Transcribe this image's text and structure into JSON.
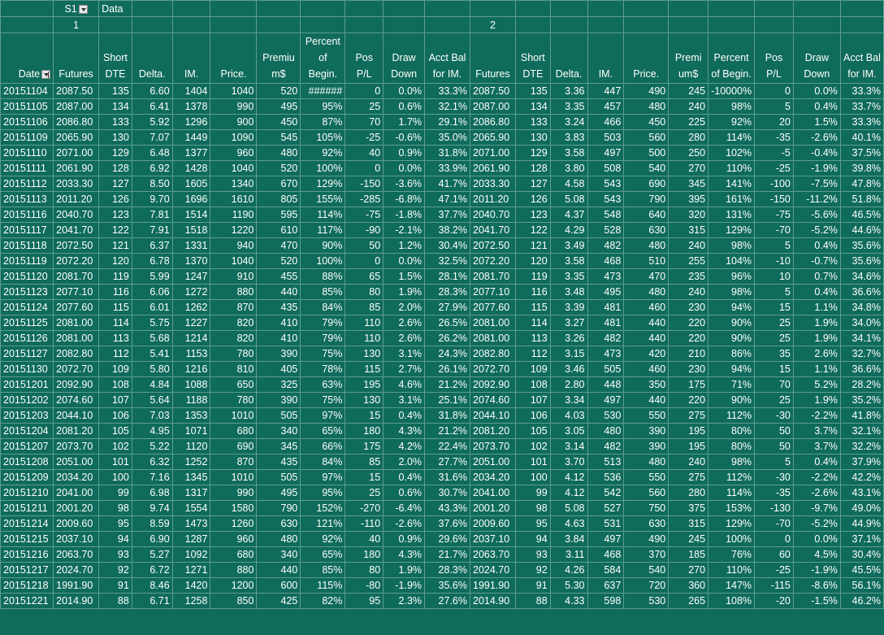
{
  "pivot": {
    "field_label": "S1",
    "data_label": "Data",
    "group1": "1",
    "group2": "2"
  },
  "headers": [
    "Date",
    "Futures",
    "Short DTE",
    "Delta.",
    "IM.",
    "Price.",
    "Premiu m$",
    "Percent of Begin.",
    "Pos P/L",
    "Draw Down",
    "Acct Bal for IM.",
    "Futures",
    "Short DTE",
    "Delta.",
    "IM.",
    "Price.",
    "Premi um$",
    "Percent of Begin.",
    "Pos P/L",
    "Draw Down",
    "Acct Bal for IM."
  ],
  "rows": [
    [
      "20151104",
      "2087.50",
      "135",
      "6.60",
      "1404",
      "1040",
      "520",
      "######",
      "0",
      "0.0%",
      "33.3%",
      "2087.50",
      "135",
      "3.36",
      "447",
      "490",
      "245",
      "-10000%",
      "0",
      "0.0%",
      "33.3%"
    ],
    [
      "20151105",
      "2087.00",
      "134",
      "6.41",
      "1378",
      "990",
      "495",
      "95%",
      "25",
      "0.6%",
      "32.1%",
      "2087.00",
      "134",
      "3.35",
      "457",
      "480",
      "240",
      "98%",
      "5",
      "0.4%",
      "33.7%"
    ],
    [
      "20151106",
      "2086.80",
      "133",
      "5.92",
      "1296",
      "900",
      "450",
      "87%",
      "70",
      "1.7%",
      "29.1%",
      "2086.80",
      "133",
      "3.24",
      "466",
      "450",
      "225",
      "92%",
      "20",
      "1.5%",
      "33.3%"
    ],
    [
      "20151109",
      "2065.90",
      "130",
      "7.07",
      "1449",
      "1090",
      "545",
      "105%",
      "-25",
      "-0.6%",
      "35.0%",
      "2065.90",
      "130",
      "3.83",
      "503",
      "560",
      "280",
      "114%",
      "-35",
      "-2.6%",
      "40.1%"
    ],
    [
      "20151110",
      "2071.00",
      "129",
      "6.48",
      "1377",
      "960",
      "480",
      "92%",
      "40",
      "0.9%",
      "31.8%",
      "2071.00",
      "129",
      "3.58",
      "497",
      "500",
      "250",
      "102%",
      "-5",
      "-0.4%",
      "37.5%"
    ],
    [
      "20151111",
      "2061.90",
      "128",
      "6.92",
      "1428",
      "1040",
      "520",
      "100%",
      "0",
      "0.0%",
      "33.9%",
      "2061.90",
      "128",
      "3.80",
      "508",
      "540",
      "270",
      "110%",
      "-25",
      "-1.9%",
      "39.8%"
    ],
    [
      "20151112",
      "2033.30",
      "127",
      "8.50",
      "1605",
      "1340",
      "670",
      "129%",
      "-150",
      "-3.6%",
      "41.7%",
      "2033.30",
      "127",
      "4.58",
      "543",
      "690",
      "345",
      "141%",
      "-100",
      "-7.5%",
      "47.8%"
    ],
    [
      "20151113",
      "2011.20",
      "126",
      "9.70",
      "1696",
      "1610",
      "805",
      "155%",
      "-285",
      "-6.8%",
      "47.1%",
      "2011.20",
      "126",
      "5.08",
      "543",
      "790",
      "395",
      "161%",
      "-150",
      "-11.2%",
      "51.8%"
    ],
    [
      "20151116",
      "2040.70",
      "123",
      "7.81",
      "1514",
      "1190",
      "595",
      "114%",
      "-75",
      "-1.8%",
      "37.7%",
      "2040.70",
      "123",
      "4.37",
      "548",
      "640",
      "320",
      "131%",
      "-75",
      "-5.6%",
      "46.5%"
    ],
    [
      "20151117",
      "2041.70",
      "122",
      "7.91",
      "1518",
      "1220",
      "610",
      "117%",
      "-90",
      "-2.1%",
      "38.2%",
      "2041.70",
      "122",
      "4.29",
      "528",
      "630",
      "315",
      "129%",
      "-70",
      "-5.2%",
      "44.6%"
    ],
    [
      "20151118",
      "2072.50",
      "121",
      "6.37",
      "1331",
      "940",
      "470",
      "90%",
      "50",
      "1.2%",
      "30.4%",
      "2072.50",
      "121",
      "3.49",
      "482",
      "480",
      "240",
      "98%",
      "5",
      "0.4%",
      "35.6%"
    ],
    [
      "20151119",
      "2072.20",
      "120",
      "6.78",
      "1370",
      "1040",
      "520",
      "100%",
      "0",
      "0.0%",
      "32.5%",
      "2072.20",
      "120",
      "3.58",
      "468",
      "510",
      "255",
      "104%",
      "-10",
      "-0.7%",
      "35.6%"
    ],
    [
      "20151120",
      "2081.70",
      "119",
      "5.99",
      "1247",
      "910",
      "455",
      "88%",
      "65",
      "1.5%",
      "28.1%",
      "2081.70",
      "119",
      "3.35",
      "473",
      "470",
      "235",
      "96%",
      "10",
      "0.7%",
      "34.6%"
    ],
    [
      "20151123",
      "2077.10",
      "116",
      "6.06",
      "1272",
      "880",
      "440",
      "85%",
      "80",
      "1.9%",
      "28.3%",
      "2077.10",
      "116",
      "3.48",
      "495",
      "480",
      "240",
      "98%",
      "5",
      "0.4%",
      "36.6%"
    ],
    [
      "20151124",
      "2077.60",
      "115",
      "6.01",
      "1262",
      "870",
      "435",
      "84%",
      "85",
      "2.0%",
      "27.9%",
      "2077.60",
      "115",
      "3.39",
      "481",
      "460",
      "230",
      "94%",
      "15",
      "1.1%",
      "34.8%"
    ],
    [
      "20151125",
      "2081.00",
      "114",
      "5.75",
      "1227",
      "820",
      "410",
      "79%",
      "110",
      "2.6%",
      "26.5%",
      "2081.00",
      "114",
      "3.27",
      "481",
      "440",
      "220",
      "90%",
      "25",
      "1.9%",
      "34.0%"
    ],
    [
      "20151126",
      "2081.00",
      "113",
      "5.68",
      "1214",
      "820",
      "410",
      "79%",
      "110",
      "2.6%",
      "26.2%",
      "2081.00",
      "113",
      "3.26",
      "482",
      "440",
      "220",
      "90%",
      "25",
      "1.9%",
      "34.1%"
    ],
    [
      "20151127",
      "2082.80",
      "112",
      "5.41",
      "1153",
      "780",
      "390",
      "75%",
      "130",
      "3.1%",
      "24.3%",
      "2082.80",
      "112",
      "3.15",
      "473",
      "420",
      "210",
      "86%",
      "35",
      "2.6%",
      "32.7%"
    ],
    [
      "20151130",
      "2072.70",
      "109",
      "5.80",
      "1216",
      "810",
      "405",
      "78%",
      "115",
      "2.7%",
      "26.1%",
      "2072.70",
      "109",
      "3.46",
      "505",
      "460",
      "230",
      "94%",
      "15",
      "1.1%",
      "36.6%"
    ],
    [
      "20151201",
      "2092.90",
      "108",
      "4.84",
      "1088",
      "650",
      "325",
      "63%",
      "195",
      "4.6%",
      "21.2%",
      "2092.90",
      "108",
      "2.80",
      "448",
      "350",
      "175",
      "71%",
      "70",
      "5.2%",
      "28.2%"
    ],
    [
      "20151202",
      "2074.60",
      "107",
      "5.64",
      "1188",
      "780",
      "390",
      "75%",
      "130",
      "3.1%",
      "25.1%",
      "2074.60",
      "107",
      "3.34",
      "497",
      "440",
      "220",
      "90%",
      "25",
      "1.9%",
      "35.2%"
    ],
    [
      "20151203",
      "2044.10",
      "106",
      "7.03",
      "1353",
      "1010",
      "505",
      "97%",
      "15",
      "0.4%",
      "31.8%",
      "2044.10",
      "106",
      "4.03",
      "530",
      "550",
      "275",
      "112%",
      "-30",
      "-2.2%",
      "41.8%"
    ],
    [
      "20151204",
      "2081.20",
      "105",
      "4.95",
      "1071",
      "680",
      "340",
      "65%",
      "180",
      "4.3%",
      "21.2%",
      "2081.20",
      "105",
      "3.05",
      "480",
      "390",
      "195",
      "80%",
      "50",
      "3.7%",
      "32.1%"
    ],
    [
      "20151207",
      "2073.70",
      "102",
      "5.22",
      "1120",
      "690",
      "345",
      "66%",
      "175",
      "4.2%",
      "22.4%",
      "2073.70",
      "102",
      "3.14",
      "482",
      "390",
      "195",
      "80%",
      "50",
      "3.7%",
      "32.2%"
    ],
    [
      "20151208",
      "2051.00",
      "101",
      "6.32",
      "1252",
      "870",
      "435",
      "84%",
      "85",
      "2.0%",
      "27.7%",
      "2051.00",
      "101",
      "3.70",
      "513",
      "480",
      "240",
      "98%",
      "5",
      "0.4%",
      "37.9%"
    ],
    [
      "20151209",
      "2034.20",
      "100",
      "7.16",
      "1345",
      "1010",
      "505",
      "97%",
      "15",
      "0.4%",
      "31.6%",
      "2034.20",
      "100",
      "4.12",
      "536",
      "550",
      "275",
      "112%",
      "-30",
      "-2.2%",
      "42.2%"
    ],
    [
      "20151210",
      "2041.00",
      "99",
      "6.98",
      "1317",
      "990",
      "495",
      "95%",
      "25",
      "0.6%",
      "30.7%",
      "2041.00",
      "99",
      "4.12",
      "542",
      "560",
      "280",
      "114%",
      "-35",
      "-2.6%",
      "43.1%"
    ],
    [
      "20151211",
      "2001.20",
      "98",
      "9.74",
      "1554",
      "1580",
      "790",
      "152%",
      "-270",
      "-6.4%",
      "43.3%",
      "2001.20",
      "98",
      "5.08",
      "527",
      "750",
      "375",
      "153%",
      "-130",
      "-9.7%",
      "49.0%"
    ],
    [
      "20151214",
      "2009.60",
      "95",
      "8.59",
      "1473",
      "1260",
      "630",
      "121%",
      "-110",
      "-2.6%",
      "37.6%",
      "2009.60",
      "95",
      "4.63",
      "531",
      "630",
      "315",
      "129%",
      "-70",
      "-5.2%",
      "44.9%"
    ],
    [
      "20151215",
      "2037.10",
      "94",
      "6.90",
      "1287",
      "960",
      "480",
      "92%",
      "40",
      "0.9%",
      "29.6%",
      "2037.10",
      "94",
      "3.84",
      "497",
      "490",
      "245",
      "100%",
      "0",
      "0.0%",
      "37.1%"
    ],
    [
      "20151216",
      "2063.70",
      "93",
      "5.27",
      "1092",
      "680",
      "340",
      "65%",
      "180",
      "4.3%",
      "21.7%",
      "2063.70",
      "93",
      "3.11",
      "468",
      "370",
      "185",
      "76%",
      "60",
      "4.5%",
      "30.4%"
    ],
    [
      "20151217",
      "2024.70",
      "92",
      "6.72",
      "1271",
      "880",
      "440",
      "85%",
      "80",
      "1.9%",
      "28.3%",
      "2024.70",
      "92",
      "4.26",
      "584",
      "540",
      "270",
      "110%",
      "-25",
      "-1.9%",
      "45.5%"
    ],
    [
      "20151218",
      "1991.90",
      "91",
      "8.46",
      "1420",
      "1200",
      "600",
      "115%",
      "-80",
      "-1.9%",
      "35.6%",
      "1991.90",
      "91",
      "5.30",
      "637",
      "720",
      "360",
      "147%",
      "-115",
      "-8.6%",
      "56.1%"
    ],
    [
      "20151221",
      "2014.90",
      "88",
      "6.71",
      "1258",
      "850",
      "425",
      "82%",
      "95",
      "2.3%",
      "27.6%",
      "2014.90",
      "88",
      "4.33",
      "598",
      "530",
      "265",
      "108%",
      "-20",
      "-1.5%",
      "46.2%"
    ]
  ],
  "colors": {
    "cell_background": "#0f6b5b",
    "gridline": "#5d9d91",
    "text": "#ffffff"
  }
}
